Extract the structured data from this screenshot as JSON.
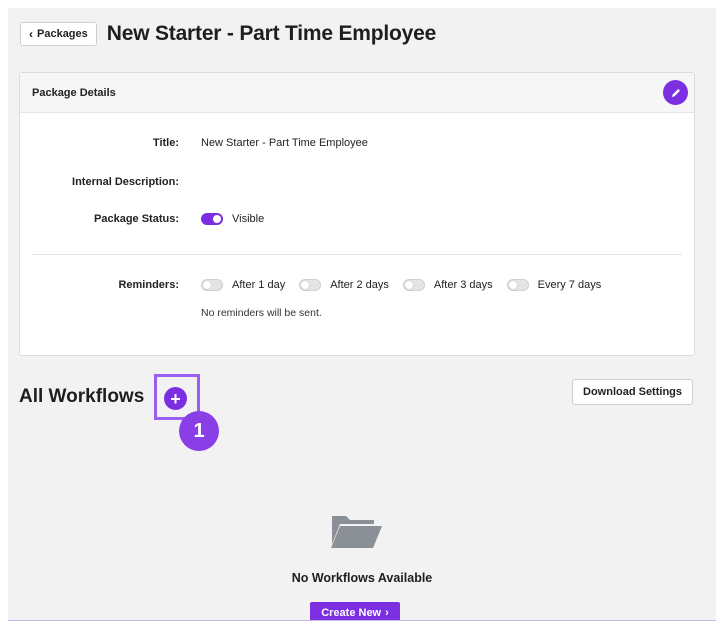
{
  "header": {
    "back_label": "Packages",
    "title": "New Starter - Part Time Employee"
  },
  "package_details": {
    "card_title": "Package Details",
    "title_label": "Title:",
    "title_value": "New Starter - Part Time Employee",
    "internal_description_label": "Internal Description:",
    "internal_description_value": "",
    "status_label": "Package Status:",
    "status_value": "Visible",
    "status_on": true,
    "reminders_label": "Reminders:",
    "reminders": [
      {
        "label": "After 1 day",
        "on": false
      },
      {
        "label": "After 2 days",
        "on": false
      },
      {
        "label": "After 3 days",
        "on": false
      },
      {
        "label": "Every 7 days",
        "on": false
      }
    ],
    "reminders_note": "No reminders will be sent."
  },
  "workflows": {
    "title": "All Workflows",
    "add_label": "+",
    "step_badge": "1",
    "download_label": "Download Settings",
    "empty_text": "No Workflows Available",
    "create_label": "Create New"
  },
  "icons": {
    "back": "chevron-left-icon",
    "edit": "pencil-icon",
    "empty": "folder-open-icon",
    "create": "chevron-right-icon"
  },
  "colors": {
    "accent": "#7b2fe0",
    "highlight": "#9a5ff0",
    "background": "#f2f2f2"
  }
}
